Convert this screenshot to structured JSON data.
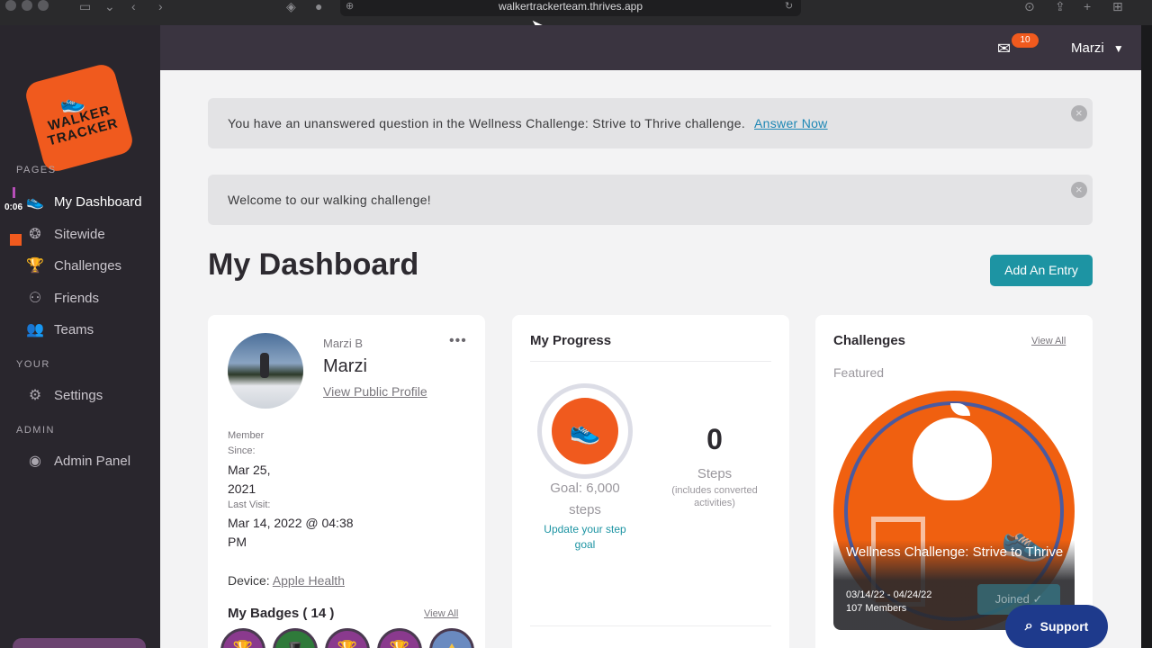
{
  "browser": {
    "url": "walkertrackerteam.thrives.app"
  },
  "sidebar": {
    "logo_line1": "WALKER",
    "logo_line2": "TRACKER",
    "section_pages": "PAGES",
    "section_your": "YOUR",
    "section_admin": "ADMIN",
    "timer": "0:06",
    "items": [
      {
        "label": "My Dashboard",
        "icon": "shoe-icon"
      },
      {
        "label": "Sitewide",
        "icon": "footprint-icon"
      },
      {
        "label": "Challenges",
        "icon": "trophy-icon"
      },
      {
        "label": "Friends",
        "icon": "friends-icon"
      },
      {
        "label": "Teams",
        "icon": "teams-icon"
      },
      {
        "label": "Settings",
        "icon": "gear-icon"
      },
      {
        "label": "Admin Panel",
        "icon": "admin-icon"
      }
    ]
  },
  "topbar": {
    "mail_count": "10",
    "user_name": "Marzi"
  },
  "alerts": [
    {
      "text": "You have an unanswered question in the Wellness Challenge: Strive to Thrive challenge.",
      "link": "Answer Now"
    },
    {
      "text": "Welcome to our walking challenge!"
    }
  ],
  "page": {
    "title": "My Dashboard",
    "add_entry": "Add An Entry"
  },
  "profile": {
    "username_small": "Marzi B",
    "display_name": "Marzi",
    "view_profile": "View Public Profile",
    "member_label_1": "Member",
    "member_label_2": "Since:",
    "member_since_1": "Mar 25,",
    "member_since_2": "2021",
    "last_visit_label": "Last Visit:",
    "last_visit_1": "Mar 14, 2022 @ 04:38",
    "last_visit_2": "PM",
    "device_label": "Device:",
    "device_value": "Apple Health",
    "badges_title": "My Badges ( 14 )",
    "badges_view_all": "View All"
  },
  "progress": {
    "title": "My Progress",
    "goal_line1": "Goal: 6,000",
    "goal_line2": "steps",
    "update_line1": "Update your step",
    "update_line2": "goal",
    "steps_value": "0",
    "steps_label": "Steps",
    "steps_note_1": "(includes converted",
    "steps_note_2": "activities)"
  },
  "challenges": {
    "title": "Challenges",
    "view_all": "View All",
    "featured": "Featured",
    "name": "Wellness Challenge: Strive to Thrive",
    "dates": "03/14/22 - 04/24/22",
    "members": "107 Members",
    "joined": "Joined ✓"
  },
  "support": {
    "label": "Support"
  },
  "colors": {
    "brand_orange": "#f05a1e",
    "teal": "#1d94a3",
    "sidebar_bg": "#29262d"
  }
}
